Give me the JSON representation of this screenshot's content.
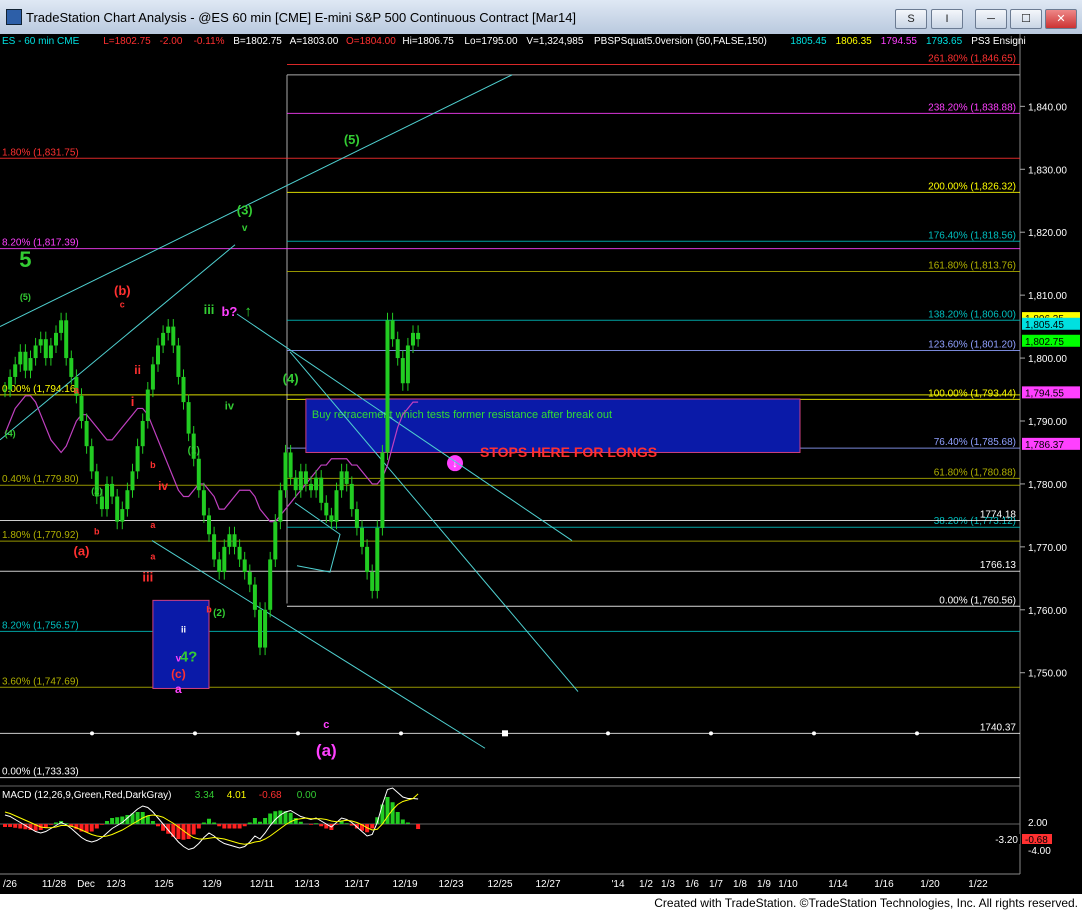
{
  "window": {
    "title": "TradeStation Chart Analysis - @ES 60 min [CME] E-mini S&P 500 Continuous Contract [Mar14]",
    "buttons": {
      "s_label": "S",
      "indicator_label": "I"
    }
  },
  "footer": "Created with TradeStation. ©TradeStation Technologies, Inc. All rights reserved.",
  "chart_data": {
    "type": "candlestick",
    "symbol_line": [
      {
        "text": "ES - 60 min   CME",
        "color": "#00e0e0"
      },
      {
        "text": "L=1802.75",
        "color": "#ff3030"
      },
      {
        "text": "-2.00",
        "color": "#ff3030"
      },
      {
        "text": "-0.11%",
        "color": "#ff3030"
      },
      {
        "text": "B=1802.75",
        "color": "#ffffff"
      },
      {
        "text": "A=1803.00",
        "color": "#ffffff"
      },
      {
        "text": "O=1804.00",
        "color": "#ff3030"
      },
      {
        "text": "Hi=1806.75",
        "color": "#ffffff"
      },
      {
        "text": "Lo=1795.00",
        "color": "#ffffff"
      },
      {
        "text": "V=1,324,985",
        "color": "#ffffff"
      },
      {
        "text": "PBSPSquat5.0version (50,FALSE,150)",
        "color": "#ffffff"
      },
      {
        "text": "1805.45",
        "color": "#00e0e0"
      },
      {
        "text": "1806.35",
        "color": "#ffff00"
      },
      {
        "text": "1794.55",
        "color": "#ff40ff"
      },
      {
        "text": "1793.65",
        "color": "#00e0e0"
      },
      {
        "text": "PS3 Ensigni",
        "color": "#ffffff"
      }
    ],
    "price_axis": {
      "min": 1732,
      "max": 1848,
      "ticks": [
        1750,
        1760,
        1770,
        1780,
        1790,
        1800,
        1810,
        1820,
        1830,
        1840
      ],
      "tick_labels": [
        "1,750.00",
        "1,760.00",
        "1,770.00",
        "1,780.00",
        "1,790.00",
        "1,800.00",
        "1,810.00",
        "1,820.00",
        "1,830.00",
        "1,840.00"
      ]
    },
    "price_tags": [
      {
        "label": "1,806.35",
        "value": 1806.35,
        "bg": "#ffff00",
        "fg": "#000000"
      },
      {
        "label": "1,805.45",
        "value": 1805.45,
        "bg": "#00e0e0",
        "fg": "#000000"
      },
      {
        "label": "1,802.75",
        "value": 1802.75,
        "bg": "#00ff00",
        "fg": "#000000"
      },
      {
        "label": "1,794.55",
        "value": 1794.55,
        "bg": "#ff40ff",
        "fg": "#000000"
      },
      {
        "label": "1,786.37",
        "value": 1786.37,
        "bg": "#ff40ff",
        "fg": "#000000"
      }
    ],
    "fib_levels": [
      {
        "label": "261.80% (1,846.65)",
        "value": 1846.65,
        "color": "#ff3030",
        "side": "right"
      },
      {
        "label": "238.20% (1,838.88)",
        "value": 1838.88,
        "color": "#ff40ff",
        "side": "right"
      },
      {
        "label": "200.00% (1,826.32)",
        "value": 1826.32,
        "color": "#ffff00",
        "side": "right"
      },
      {
        "label": "176.40% (1,818.56)",
        "value": 1818.56,
        "color": "#00bfbf",
        "side": "right"
      },
      {
        "label": "161.80% (1,813.76)",
        "value": 1813.76,
        "color": "#b0b000",
        "side": "right"
      },
      {
        "label": "138.20% (1,806.00)",
        "value": 1806.0,
        "color": "#00bfbf",
        "side": "right"
      },
      {
        "label": "123.60% (1,801.20)",
        "value": 1801.2,
        "color": "#8fa0ff",
        "side": "right"
      },
      {
        "label": "100.00% (1,793.44)",
        "value": 1793.44,
        "color": "#ffff00",
        "side": "right"
      },
      {
        "label": "76.40% (1,785.68)",
        "value": 1785.68,
        "color": "#8fa0ff",
        "side": "right"
      },
      {
        "label": "61.80% (1,780.88)",
        "value": 1780.88,
        "color": "#b0b000",
        "side": "right"
      },
      {
        "label": "38.20% (1,773.12)",
        "value": 1773.12,
        "color": "#00bfbf",
        "side": "right"
      },
      {
        "label": "0.00% (1,760.56)",
        "value": 1760.56,
        "color": "#ffffff",
        "side": "right"
      },
      {
        "label": "1.80% (1,831.75)",
        "value": 1831.75,
        "color": "#ff3030",
        "side": "left"
      },
      {
        "label": "8.20% (1,817.39)",
        "value": 1817.39,
        "color": "#ff40ff",
        "side": "left"
      },
      {
        "label": "0.00% (1,794.16)",
        "value": 1794.16,
        "color": "#ffff00",
        "side": "left"
      },
      {
        "label": "0.40% (1,779.80)",
        "value": 1779.8,
        "color": "#b0b000",
        "side": "left"
      },
      {
        "label": "1.80% (1,770.92)",
        "value": 1770.92,
        "color": "#b0b000",
        "side": "left"
      },
      {
        "label": "8.20% (1,756.57)",
        "value": 1756.57,
        "color": "#00bfbf",
        "side": "left"
      },
      {
        "label": "3.60% (1,747.69)",
        "value": 1747.69,
        "color": "#b0b000",
        "side": "left"
      },
      {
        "label": "0.00% (1,733.33)",
        "value": 1733.33,
        "color": "#ffffff",
        "side": "left"
      }
    ],
    "plain_levels": [
      {
        "label": "1774.18",
        "value": 1774.18
      },
      {
        "label": "1766.13",
        "value": 1766.13
      },
      {
        "label": "1740.37",
        "value": 1740.37
      }
    ],
    "date_axis": {
      "labels": [
        "/26",
        "11/28",
        "Dec",
        "12/3",
        "12/5",
        "12/9",
        "12/11",
        "12/13",
        "12/17",
        "12/19",
        "12/23",
        "12/25",
        "12/27",
        "'14",
        "1/2",
        "1/3",
        "1/6",
        "1/7",
        "1/8",
        "1/9",
        "1/10",
        "1/14",
        "1/16",
        "1/20",
        "1/22"
      ],
      "last_bar_index": 81
    },
    "price_series": [
      1795,
      1797,
      1799,
      1801,
      1798,
      1800,
      1802,
      1803,
      1800,
      1802,
      1804,
      1806,
      1800,
      1797,
      1794,
      1790,
      1786,
      1782,
      1778,
      1776,
      1780,
      1778,
      1774,
      1776,
      1779,
      1782,
      1786,
      1790,
      1795,
      1799,
      1802,
      1804,
      1805,
      1802,
      1797,
      1793,
      1788,
      1784,
      1779,
      1775,
      1772,
      1768,
      1766,
      1770,
      1772,
      1770,
      1768,
      1766,
      1764,
      1760,
      1754,
      1760,
      1768,
      1774,
      1779,
      1785,
      1781,
      1779,
      1782,
      1780,
      1779,
      1781,
      1777,
      1775,
      1774,
      1779,
      1782,
      1780,
      1776,
      1773,
      1770,
      1766,
      1763,
      1773,
      1785,
      1806,
      1803,
      1800,
      1796,
      1802,
      1804,
      1803
    ],
    "wave_labels": [
      {
        "text": "5",
        "bar": 4,
        "price": 1814.5,
        "color": "#33cc33",
        "size": 22
      },
      {
        "text": "(5)",
        "bar": 4,
        "price": 1809.2,
        "color": "#33cc33",
        "size": 9
      },
      {
        "text": "(b)",
        "bar": 23,
        "price": 1810.0,
        "color": "#ff3030",
        "size": 13
      },
      {
        "text": "c",
        "bar": 23,
        "price": 1808.0,
        "color": "#ff3030",
        "size": 9
      },
      {
        "text": "a",
        "bar": 14,
        "price": 1794.4,
        "color": "#ff3030",
        "size": 10
      },
      {
        "text": "(4)",
        "bar": 1,
        "price": 1787.5,
        "color": "#33cc33",
        "size": 9
      },
      {
        "text": "(2)",
        "bar": 18,
        "price": 1778.4,
        "color": "#33cc33",
        "size": 9
      },
      {
        "text": "b",
        "bar": 18,
        "price": 1772.0,
        "color": "#ff3030",
        "size": 9
      },
      {
        "text": "(a)",
        "bar": 15,
        "price": 1768.6,
        "color": "#ff3030",
        "size": 13
      },
      {
        "text": "ii",
        "bar": 26,
        "price": 1797.5,
        "color": "#ff3030",
        "size": 12
      },
      {
        "text": "i",
        "bar": 25,
        "price": 1792.4,
        "color": "#ff3030",
        "size": 13
      },
      {
        "text": "iv",
        "bar": 31,
        "price": 1779.0,
        "color": "#ff3030",
        "size": 12
      },
      {
        "text": "iii",
        "bar": 28,
        "price": 1764.5,
        "color": "#ff3030",
        "size": 13
      },
      {
        "text": "a",
        "bar": 29,
        "price": 1773.0,
        "color": "#ff3030",
        "size": 9
      },
      {
        "text": "a",
        "bar": 29,
        "price": 1768.0,
        "color": "#ff3030",
        "size": 9
      },
      {
        "text": "b",
        "bar": 29,
        "price": 1782.5,
        "color": "#ff3030",
        "size": 9
      },
      {
        "text": "(1)",
        "bar": 37,
        "price": 1784.8,
        "color": "#33cc33",
        "size": 10
      },
      {
        "text": "ii",
        "bar": 35,
        "price": 1756.4,
        "color": "#ffffff",
        "size": 9
      },
      {
        "text": "v",
        "bar": 34,
        "price": 1751.8,
        "color": "#ff40ff",
        "size": 10
      },
      {
        "text": "4?",
        "bar": 36,
        "price": 1751.8,
        "color": "#33cc33",
        "size": 15
      },
      {
        "text": "(c)",
        "bar": 34,
        "price": 1749.2,
        "color": "#ff3030",
        "size": 12
      },
      {
        "text": "a",
        "bar": 34,
        "price": 1746.8,
        "color": "#ff40ff",
        "size": 12
      },
      {
        "text": "b",
        "bar": 40,
        "price": 1759.6,
        "color": "#ff3030",
        "size": 9
      },
      {
        "text": "(2)",
        "bar": 42,
        "price": 1759.0,
        "color": "#33cc33",
        "size": 10
      },
      {
        "text": "iii",
        "bar": 40,
        "price": 1807.0,
        "color": "#33cc33",
        "size": 13
      },
      {
        "text": "b?",
        "bar": 44,
        "price": 1806.7,
        "color": "#ff40ff",
        "size": 13
      },
      {
        "text": "iv",
        "bar": 44,
        "price": 1791.8,
        "color": "#33cc33",
        "size": 11
      },
      {
        "text": "(3)",
        "bar": 47,
        "price": 1822.8,
        "color": "#33cc33",
        "size": 13
      },
      {
        "text": "v",
        "bar": 47,
        "price": 1820.2,
        "color": "#33cc33",
        "size": 10
      },
      {
        "text": "(5)",
        "bar": 68,
        "price": 1834.0,
        "color": "#33cc33",
        "size": 13
      },
      {
        "text": "(4)",
        "bar": 56,
        "price": 1796.0,
        "color": "#33cc33",
        "size": 13
      },
      {
        "text": "c",
        "bar": 63,
        "price": 1741.2,
        "color": "#ff40ff",
        "size": 11
      },
      {
        "text": "(a)",
        "bar": 63,
        "price": 1736.8,
        "color": "#ff40ff",
        "size": 17
      }
    ],
    "annotations": {
      "box_text": "Buy retracement which tests former resistance after break out",
      "stops_text": "STOPS HERE FOR LONGS"
    },
    "macd": {
      "label": "MACD (12,26,9,Green,Red,DarkGray)",
      "values": [
        {
          "text": "3.34",
          "color": "#33cc33"
        },
        {
          "text": "4.01",
          "color": "#ffff00"
        },
        {
          "text": "-0.68",
          "color": "#ff3030"
        },
        {
          "text": "0.00",
          "color": "#33cc33"
        }
      ],
      "axis_labels": [
        "2.00",
        "-4.00"
      ],
      "tags": [
        {
          "label": "-3.20",
          "bg": "#000000",
          "fg": "#ffffff"
        },
        {
          "label": "-0.68",
          "bg": "#ff3030",
          "fg": "#000000"
        }
      ],
      "line": [
        1.2,
        1.0,
        0.6,
        0.2,
        -0.2,
        -0.6,
        -1.0,
        -1.2,
        -1.0,
        -0.6,
        -0.2,
        0.2,
        -0.1,
        -0.6,
        -1.2,
        -1.8,
        -2.2,
        -2.4,
        -2.2,
        -1.8,
        -1.2,
        -0.6,
        -0.2,
        0.2,
        0.8,
        1.4,
        2.0,
        2.4,
        2.2,
        1.6,
        0.8,
        0.0,
        -0.8,
        -1.6,
        -2.4,
        -3.0,
        -3.4,
        -3.2,
        -2.6,
        -1.8,
        -1.2,
        -1.6,
        -2.2,
        -2.6,
        -2.8,
        -3.0,
        -3.2,
        -3.0,
        -2.4,
        -1.6,
        -2.0,
        -1.2,
        -0.2,
        0.6,
        1.2,
        1.6,
        1.8,
        1.4,
        1.0,
        0.8,
        0.6,
        0.8,
        0.4,
        0.0,
        -0.4,
        0.2,
        0.8,
        0.6,
        0.2,
        -0.4,
        -1.0,
        -1.6,
        -1.4,
        0.2,
        2.6,
        4.6,
        4.8,
        4.2,
        3.6,
        3.4,
        3.4,
        3.34
      ],
      "signal": [
        1.6,
        1.4,
        1.1,
        0.8,
        0.5,
        0.2,
        -0.1,
        -0.4,
        -0.5,
        -0.5,
        -0.4,
        -0.2,
        -0.2,
        -0.3,
        -0.5,
        -0.8,
        -1.1,
        -1.4,
        -1.6,
        -1.7,
        -1.6,
        -1.4,
        -1.1,
        -0.8,
        -0.4,
        0.0,
        0.4,
        0.8,
        1.1,
        1.2,
        1.1,
        0.9,
        0.5,
        0.1,
        -0.4,
        -0.9,
        -1.4,
        -1.8,
        -2.0,
        -2.0,
        -1.9,
        -1.8,
        -1.9,
        -2.0,
        -2.2,
        -2.4,
        -2.6,
        -2.7,
        -2.6,
        -2.4,
        -2.3,
        -2.0,
        -1.6,
        -1.1,
        -0.6,
        -0.1,
        0.3,
        0.6,
        0.7,
        0.8,
        0.7,
        0.7,
        0.7,
        0.6,
        0.4,
        0.3,
        0.4,
        0.5,
        0.4,
        0.2,
        -0.1,
        -0.5,
        -0.8,
        -0.7,
        0.0,
        1.0,
        1.9,
        2.6,
        3.0,
        3.2,
        3.4,
        4.01
      ]
    }
  }
}
